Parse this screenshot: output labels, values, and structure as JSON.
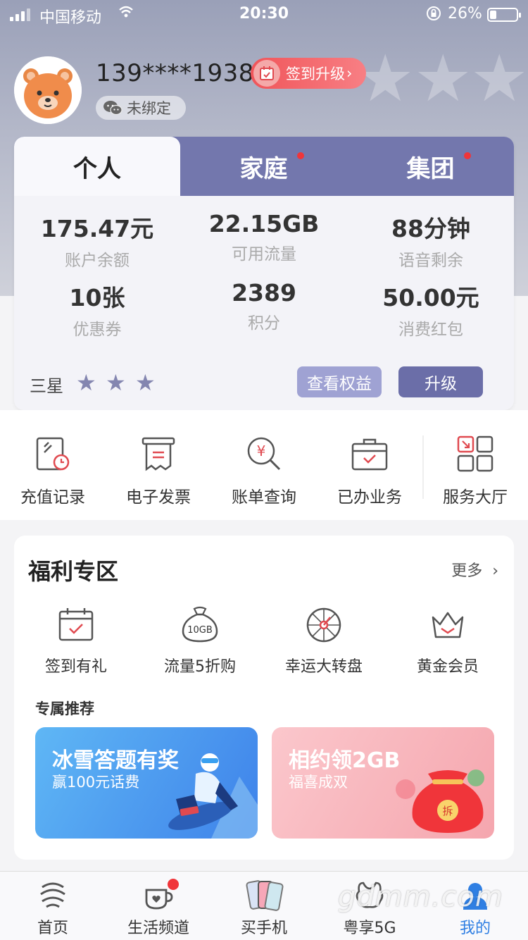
{
  "status_bar": {
    "carrier": "中国移动",
    "time": "20:30",
    "battery_percent": "26%",
    "battery_level": 0.26
  },
  "profile": {
    "phone": "139****1938",
    "sign_badge": "签到升级",
    "wechat_status": "未绑定",
    "avatar_icon": "bear-avatar-icon"
  },
  "account": {
    "tabs": [
      {
        "label": "个人",
        "active": true,
        "dot": false
      },
      {
        "label": "家庭",
        "active": false,
        "dot": true
      },
      {
        "label": "集团",
        "active": false,
        "dot": true
      }
    ],
    "stats": [
      {
        "value": "175.47元",
        "label": "账户余额"
      },
      {
        "value": "22.15GB",
        "label": "可用流量"
      },
      {
        "value": "88分钟",
        "label": "语音剩余"
      },
      {
        "value": "10张",
        "label": "优惠券"
      },
      {
        "value": "2389",
        "label": "积分"
      },
      {
        "value": "50.00元",
        "label": "消费红包"
      }
    ],
    "level_label": "三星",
    "level_stars": 3,
    "view_benefits": "查看权益",
    "upgrade": "升级"
  },
  "quick_services": [
    {
      "label": "充值记录",
      "icon": "recharge-record-icon"
    },
    {
      "label": "电子发票",
      "icon": "invoice-icon"
    },
    {
      "label": "账单查询",
      "icon": "bill-search-icon"
    },
    {
      "label": "已办业务",
      "icon": "briefcase-icon"
    },
    {
      "label": "服务大厅",
      "icon": "service-hall-icon"
    }
  ],
  "welfare": {
    "title": "福利专区",
    "more": "更多",
    "items": [
      {
        "label": "签到有礼",
        "icon": "calendar-check-icon"
      },
      {
        "label": "流量5折购",
        "icon": "data-bag-icon"
      },
      {
        "label": "幸运大转盘",
        "icon": "wheel-icon"
      },
      {
        "label": "黄金会员",
        "icon": "crown-icon"
      }
    ],
    "bag_text": "10GB",
    "recommend_title": "专属推荐",
    "banners": [
      {
        "title": "冰雪答题有奖",
        "subtitle": "赢100元话费"
      },
      {
        "title": "相约领2GB",
        "subtitle": "福喜成双"
      }
    ]
  },
  "bottom_nav": [
    {
      "label": "首页",
      "icon": "cmcc-logo-icon",
      "active": false
    },
    {
      "label": "生活频道",
      "icon": "coffee-cup-icon",
      "active": false
    },
    {
      "label": "买手机",
      "icon": "phone-icon",
      "active": false
    },
    {
      "label": "粤享5G",
      "icon": "5g-icon",
      "active": false
    },
    {
      "label": "我的",
      "icon": "person-icon",
      "active": true
    }
  ],
  "watermark": "gdmm.com",
  "colors": {
    "tab_bar": "#7377ad",
    "accent_red": "#f0353a",
    "active_nav": "#2f7fe3",
    "benefit_button": "#9fa2d3",
    "upgrade_button": "#6b6ea8"
  }
}
